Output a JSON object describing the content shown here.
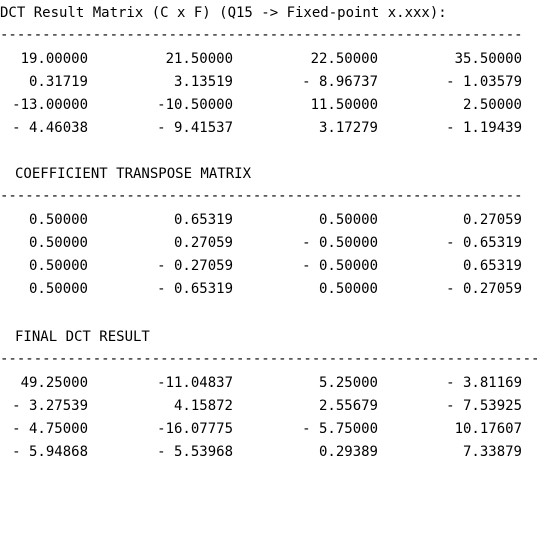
{
  "header": {
    "title": "DCT Result Matrix (C x F) (Q15 -> Fixed-point x.xxx):",
    "divider": "--------------------------------------------------------------"
  },
  "matrix1": {
    "rows": [
      [
        "19.00000",
        "21.50000",
        "22.50000",
        "35.50000"
      ],
      [
        "0.31719",
        "3.13519",
        "- 8.96737",
        "- 1.03579"
      ],
      [
        "-13.00000",
        "-10.50000",
        "11.50000",
        "2.50000"
      ],
      [
        "- 4.46038",
        "- 9.41537",
        "3.17279",
        "- 1.19439"
      ]
    ]
  },
  "section2": {
    "title": "COEFFICIENT TRANSPOSE MATRIX",
    "divider": "--------------------------------------------------------------"
  },
  "matrix2": {
    "rows": [
      [
        "0.50000",
        "0.65319",
        "0.50000",
        "0.27059"
      ],
      [
        "0.50000",
        "0.27059",
        "- 0.50000",
        "- 0.65319"
      ],
      [
        "0.50000",
        "- 0.27059",
        "- 0.50000",
        "0.65319"
      ],
      [
        "0.50000",
        "- 0.65319",
        "0.50000",
        "- 0.27059"
      ]
    ]
  },
  "section3": {
    "title": "FINAL DCT RESULT",
    "divider": "----------------------------------------------------------------"
  },
  "matrix3": {
    "rows": [
      [
        "49.25000",
        "-11.04837",
        "5.25000",
        "- 3.81169"
      ],
      [
        "- 3.27539",
        "4.15872",
        "2.55679",
        "- 7.53925"
      ],
      [
        "- 4.75000",
        "-16.07775",
        "- 5.75000",
        "10.17607"
      ],
      [
        "- 5.94868",
        "- 5.53968",
        "0.29389",
        "7.33879"
      ]
    ]
  }
}
